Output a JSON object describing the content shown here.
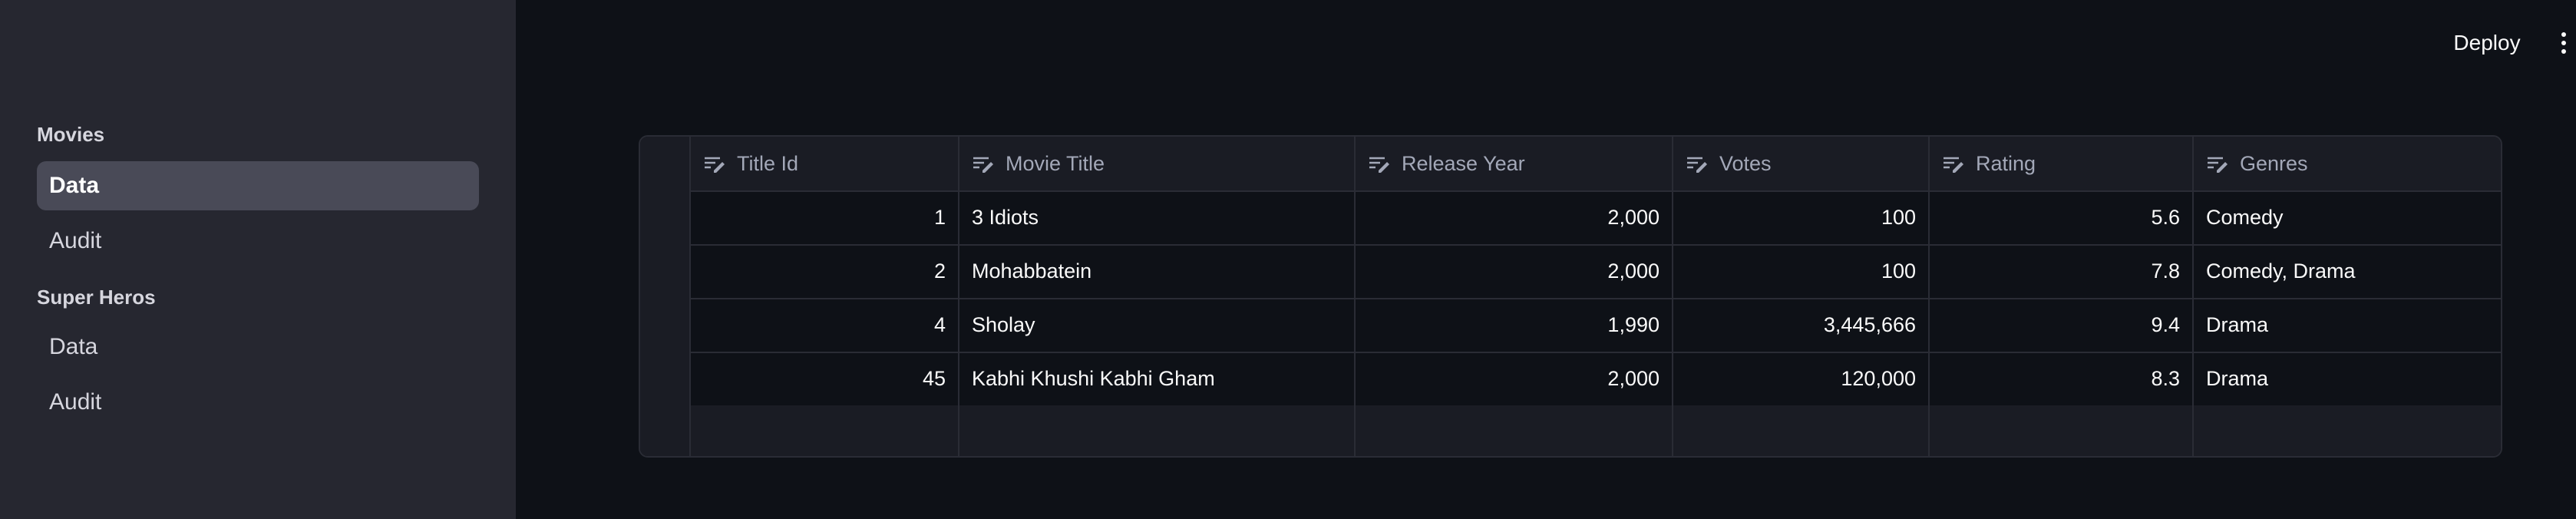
{
  "sidebar": {
    "sections": [
      {
        "label": "Movies",
        "items": [
          {
            "label": "Data",
            "active": true
          },
          {
            "label": "Audit",
            "active": false
          }
        ]
      },
      {
        "label": "Super Heros",
        "items": [
          {
            "label": "Data",
            "active": false
          },
          {
            "label": "Audit",
            "active": false
          }
        ]
      }
    ]
  },
  "header": {
    "deploy_label": "Deploy",
    "menu_icon": "vertical-dots-icon"
  },
  "table": {
    "column_icon": "text-column-icon",
    "columns": [
      "Title Id",
      "Movie Title",
      "Release Year",
      "Votes",
      "Rating",
      "Genres"
    ],
    "rows": [
      [
        "1",
        "3 Idiots",
        "2,000",
        "100",
        "5.6",
        "Comedy"
      ],
      [
        "2",
        "Mohabbatein",
        "2,000",
        "100",
        "7.8",
        "Comedy, Drama"
      ],
      [
        "4",
        "Sholay",
        "1,990",
        "3,445,666",
        "9.4",
        "Drama"
      ],
      [
        "45",
        "Kabhi Khushi Kabhi Gham",
        "2,000",
        "120,000",
        "8.3",
        "Drama"
      ]
    ]
  },
  "colors": {
    "background": "#0e1117",
    "sidebar": "#262730",
    "active_item": "#494a57",
    "grid_header": "#1a1c24",
    "border": "#2a2c35"
  }
}
